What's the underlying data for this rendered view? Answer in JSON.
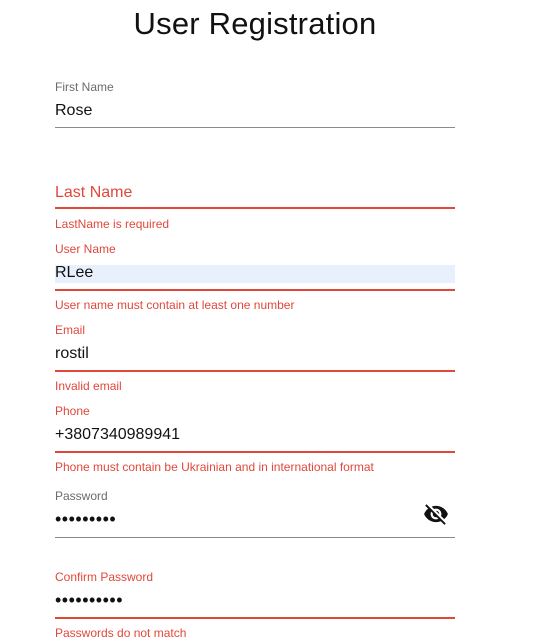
{
  "page": {
    "title": "User Registration"
  },
  "form": {
    "first_name": {
      "label": "First Name",
      "value": "Rose"
    },
    "last_name": {
      "placeholder": "Last Name",
      "value": "",
      "error": "LastName is required"
    },
    "user_name": {
      "label": "User Name",
      "value": "RLee",
      "error": "User name must contain at least one number"
    },
    "email": {
      "label": "Email",
      "value": "rostil",
      "error": "Invalid email"
    },
    "phone": {
      "label": "Phone",
      "value": "+3807340989941",
      "error": "Phone must contain be Ukrainian and in international format"
    },
    "password": {
      "label": "Password",
      "value": "•••••••••",
      "toggle_icon": "eye-off-icon"
    },
    "confirm_password": {
      "label": "Confirm Password",
      "value": "••••••••••",
      "error": "Passwords do not match"
    }
  },
  "colors": {
    "error": "#e0483b",
    "label": "#6b6b6b",
    "underline": "#8a8a8a",
    "autofill_bg": "#e8f0fe"
  }
}
